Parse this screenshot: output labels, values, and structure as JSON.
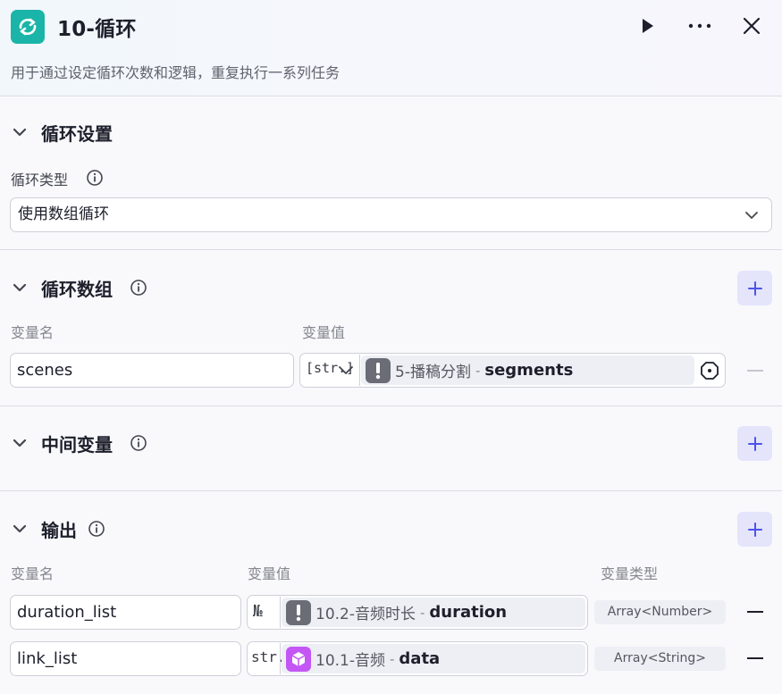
{
  "header": {
    "title": "10-循环",
    "description": "用于通过设定循环次数和逻辑，重复执行一系列任务",
    "icons": {
      "app": "loop-icon",
      "run": "play-icon",
      "more": "more-icon",
      "close": "close-icon"
    }
  },
  "loop_settings": {
    "title": "循环设置",
    "type_label": "循环类型",
    "type_value": "使用数组循环"
  },
  "loop_array": {
    "title": "循环数组",
    "col_name": "变量名",
    "col_value": "变量值",
    "rows": [
      {
        "name": "scenes",
        "type": "[str.]",
        "node": "5-播稿分割",
        "sep": "-",
        "field": "segments"
      }
    ]
  },
  "middle_vars": {
    "title": "中间变量"
  },
  "output": {
    "title": "输出",
    "col_name": "变量名",
    "col_value": "变量值",
    "col_type": "变量类型",
    "rows": [
      {
        "name": "duration_list",
        "type": "№",
        "node": "10.2-音频时长",
        "sep": "-",
        "field": "duration",
        "var_type": "Array<Number>"
      },
      {
        "name": "link_list",
        "type": "str.",
        "node": "10.1-音频",
        "sep": "-",
        "field": "data",
        "var_type": "Array<String>"
      }
    ]
  },
  "colors": {
    "accent": "#4d53e8",
    "app_icon": "#1ab5a8",
    "warn_icon": "#6b6d76",
    "audio_icon": "#c356f5"
  }
}
